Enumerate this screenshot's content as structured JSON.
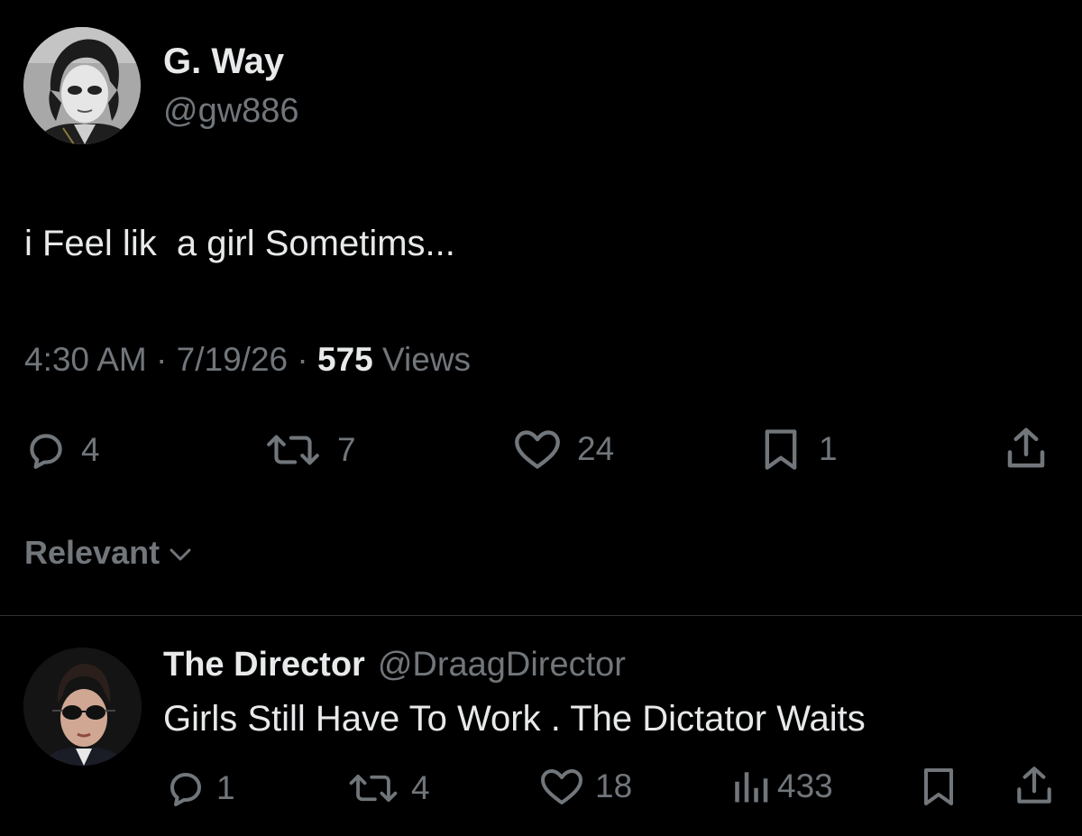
{
  "tweet": {
    "author_name": "G. Way",
    "author_handle": "@gw886",
    "text": "i Feel lik  a girl Sometims...",
    "time": "4:30 AM",
    "date": "7/19/26",
    "views_count": "575",
    "views_label": "Views",
    "separator": "·",
    "actions": {
      "replies": "4",
      "reposts": "7",
      "likes": "24",
      "bookmarks": "1"
    }
  },
  "sort": {
    "label": "Relevant"
  },
  "reply": {
    "author_name": "The Director",
    "author_handle": "@DraagDirector",
    "text": "Girls Still Have To Work . The Dictator Waits",
    "actions": {
      "replies": "1",
      "reposts": "4",
      "likes": "18",
      "views": "433"
    }
  },
  "icons": {
    "reply": "reply-icon",
    "repost": "repost-icon",
    "like": "heart-icon",
    "bookmark": "bookmark-icon",
    "share": "share-icon",
    "views": "views-icon",
    "chevron": "chevron-down-icon"
  },
  "colors": {
    "background": "#000000",
    "primary_text": "#e7e9ea",
    "secondary_text": "#71767b",
    "divider": "#2f3336"
  }
}
